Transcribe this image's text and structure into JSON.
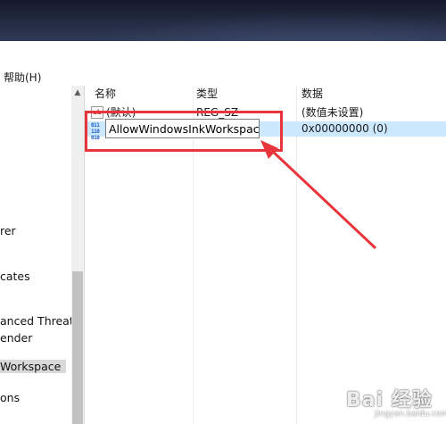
{
  "menu": {
    "help": "帮助(H)"
  },
  "tree": {
    "items": [
      "rer",
      "cates",
      "anced Threat P",
      "ender",
      "Workspace",
      "ons"
    ]
  },
  "values": {
    "headers": {
      "name": "名称",
      "type": "类型",
      "data": "数据"
    },
    "rows": [
      {
        "name": "(默认)",
        "type": "REG_SZ",
        "data": "(数值未设置)",
        "icon": "reg-sz-icon"
      },
      {
        "name": "AllowWindowsInkWorkspace",
        "type": "",
        "data": "0x00000000 (0)",
        "icon": "reg-dword-icon",
        "editing": true
      }
    ]
  },
  "watermark": {
    "text": "Bai 经验",
    "sub": "jingyan.baidu.com"
  },
  "colors": {
    "selection": "#cce8ff",
    "annotation": "#e8353b"
  }
}
